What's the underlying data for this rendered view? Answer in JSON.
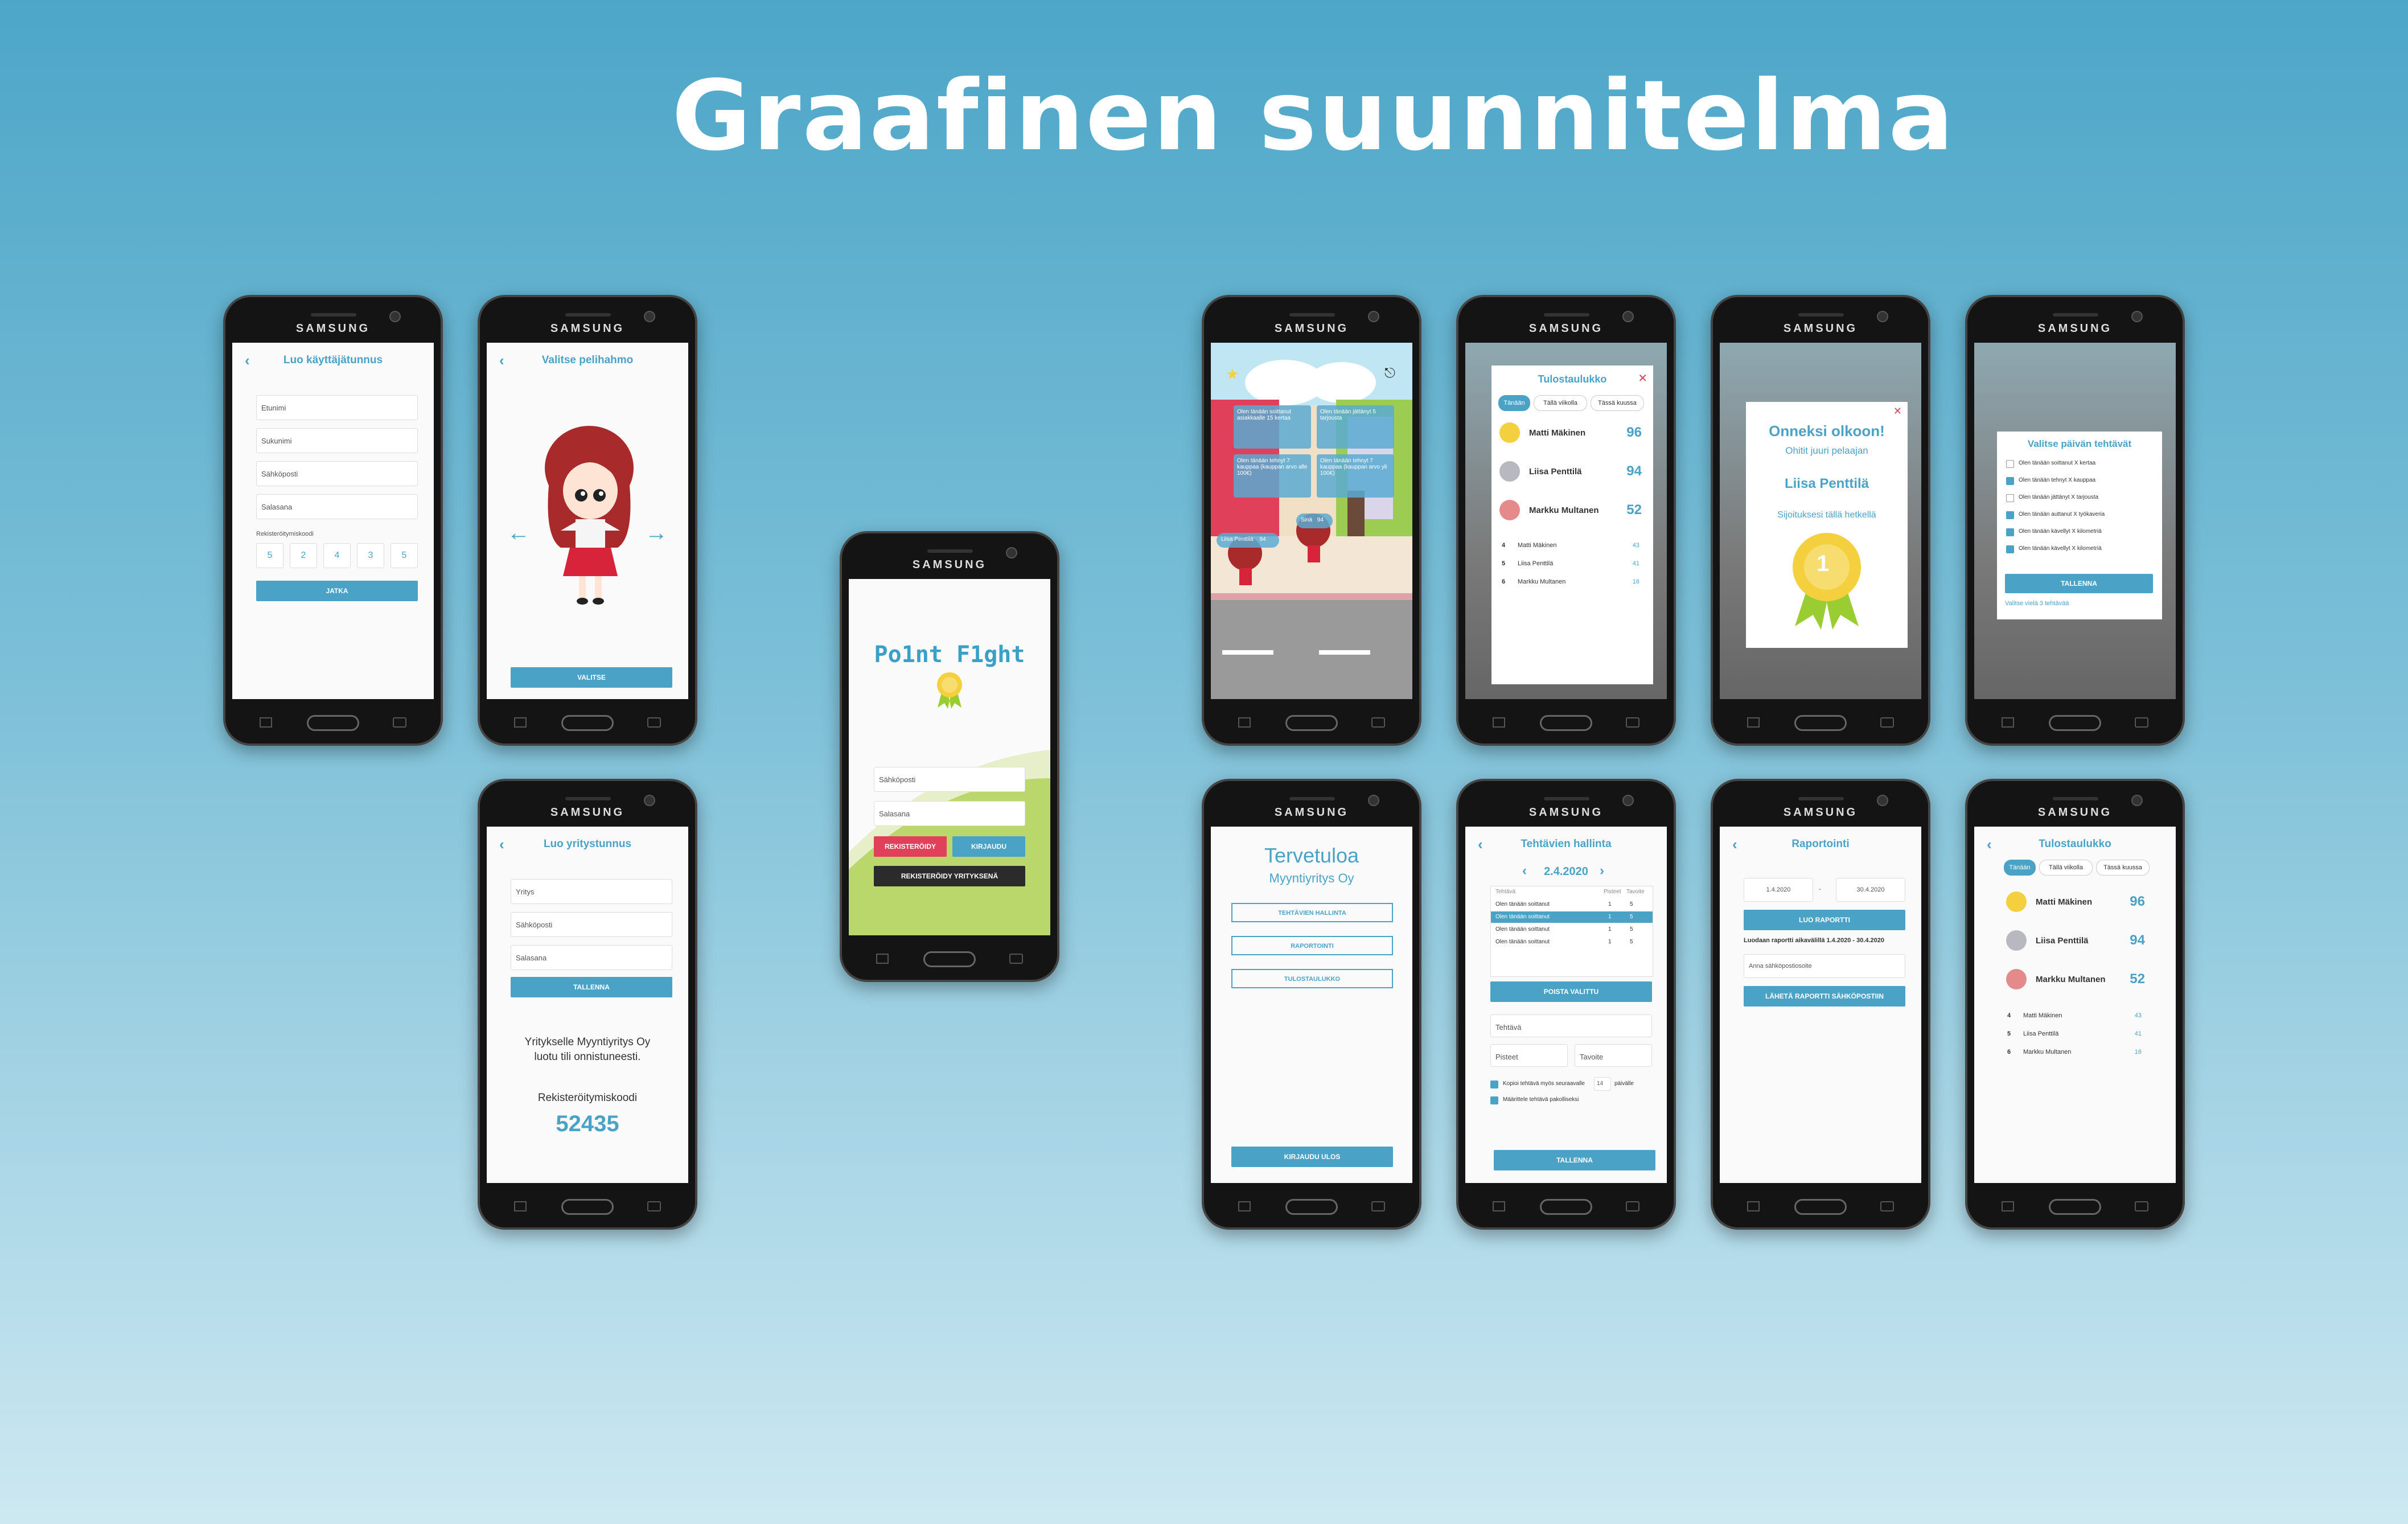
{
  "title": "Graafinen suunnitelma",
  "brand": "SAMSUNG",
  "colors": {
    "accent": "#4aa3c7",
    "danger": "#e0405a",
    "dark": "#2b2b2b",
    "green": "#b9d76a"
  },
  "register": {
    "header": "Luo käyttäjätunnus",
    "fields": [
      "Etunimi",
      "Sukunimi",
      "Sähköposti",
      "Salasana"
    ],
    "code_label": "Rekisteröitymiskoodi",
    "code_digits": [
      "5",
      "2",
      "4",
      "3",
      "5"
    ],
    "continue": "JATKA"
  },
  "avatar": {
    "header": "Valitse pelihahmo",
    "select": "VALITSE"
  },
  "company_register": {
    "header": "Luo yritystunnus",
    "fields": [
      "Yritys",
      "Sähköposti",
      "Salasana"
    ],
    "save": "TALLENNA",
    "success": "Yritykselle Myyntiyritys Oy luotu tili onnistuneesti.",
    "code_label": "Rekisteröitymiskoodi",
    "code": "52435"
  },
  "login": {
    "logo": "Po1nt F1ght",
    "email": "Sähköposti",
    "password": "Salasana",
    "register": "REKISTERÖIDY",
    "login": "KIRJAUDU",
    "register_company": "REKISTERÖIDY YRITYKSENÄ"
  },
  "game": {
    "bubbles": [
      "Olen tänään soittanut asiakkaalle 15 kertaa",
      "Olen tänään jättänyt 5 tarjousta",
      "Olen tänään tehnyt 7 kauppaa (kauppan arvo alle 100€)",
      "Olen tänään tehnyt 7 kauppaa (kauppan arvo yli 100€)"
    ],
    "player1_name": "Liisa Penttilä",
    "player1_score": "94",
    "player2_name": "Sinä",
    "player2_score": "94"
  },
  "leaderboard": {
    "header": "Tulostaulukko",
    "tabs": [
      "Tänään",
      "Tällä viikolla",
      "Tässä kuussa"
    ],
    "top": [
      {
        "name": "Matti Mäkinen",
        "score": "96"
      },
      {
        "name": "Liisa Penttilä",
        "score": "94"
      },
      {
        "name": "Markku Multanen",
        "score": "52"
      }
    ],
    "rest": [
      {
        "rank": "4",
        "name": "Matti Mäkinen",
        "score": "43"
      },
      {
        "rank": "5",
        "name": "Liisa Penttilä",
        "score": "41"
      },
      {
        "rank": "6",
        "name": "Markku Multanen",
        "score": "16"
      }
    ]
  },
  "congrats": {
    "title": "Onneksi olkoon!",
    "subtitle": "Ohitit juuri pelaajan",
    "player": "Liisa Penttilä",
    "position": "Sijoituksesi tällä hetkellä",
    "rank": "1"
  },
  "daily_tasks": {
    "title": "Valitse päivän tehtävät",
    "items": [
      {
        "label": "Olen tänään soittanut X kertaa",
        "checked": false
      },
      {
        "label": "Olen tänään tehnyt X kauppaa",
        "checked": true
      },
      {
        "label": "Olen tänään jättänyt X tarjousta",
        "checked": false
      },
      {
        "label": "Olen tänään auttanut X työkaveria",
        "checked": true
      },
      {
        "label": "Olen tänään kävellyt X kilometriä",
        "checked": true
      },
      {
        "label": "Olen tänään kävellyt X kilometriä",
        "checked": true
      }
    ],
    "save": "TALLENNA",
    "note": "Valitse vielä 3 tehtävää"
  },
  "welcome": {
    "title": "Tervetuloa",
    "company": "Myyntiyritys Oy",
    "buttons": [
      "TEHTÄVIEN HALLINTA",
      "RAPORTOINTI",
      "TULOSTAULUKKO"
    ],
    "logout": "KIRJAUDU ULOS"
  },
  "task_mgmt": {
    "header": "Tehtävien hallinta",
    "date": "2.4.2020",
    "cols": [
      "Tehtävä",
      "Pisteet",
      "Tavoite"
    ],
    "rows": [
      {
        "task": "Olen tänään soittanut",
        "points": "1",
        "goal": "5"
      },
      {
        "task": "Olen tänään soittanut",
        "points": "1",
        "goal": "5"
      },
      {
        "task": "Olen tänään soittanut",
        "points": "1",
        "goal": "5"
      },
      {
        "task": "Olen tänään soittanut",
        "points": "1",
        "goal": "5"
      }
    ],
    "delete": "POISTA VALITTU",
    "task_field": "Tehtävä",
    "points_field": "Pisteet",
    "goal_field": "Tavoite",
    "copy_label": "Kopioi tehtävä myös seuraavalle",
    "copy_days": "14",
    "days_label": "päivälle",
    "mandatory_label": "Määrittele tehtävä pakolliseksi",
    "save": "TALLENNA"
  },
  "reporting": {
    "header": "Raportointi",
    "from": "1.4.2020",
    "to": "30.4.2020",
    "create": "LUO RAPORTTI",
    "created_text": "Luodaan raportti aikavälillä 1.4.2020 - 30.4.2020",
    "email_placeholder": "Anna sähköpostiosoite",
    "send": "LÄHETÄ RAPORTTI SÄHKÖPOSTIIN"
  }
}
